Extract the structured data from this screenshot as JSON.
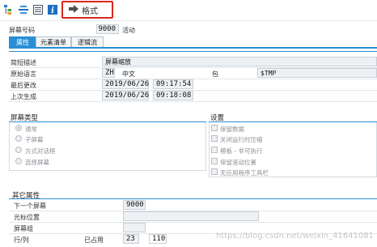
{
  "toolbar": {
    "format_label": "格式",
    "icons": [
      "hierarchy-icon",
      "align-icon",
      "list-icon",
      "info-icon",
      "arrow-right-icon"
    ]
  },
  "header": {
    "screen_no_label": "屏幕号码",
    "screen_no_value": "9000",
    "status": "活动"
  },
  "tabs": [
    {
      "label": "属性",
      "active": true
    },
    {
      "label": "元素清单",
      "active": false
    },
    {
      "label": "逻辑流",
      "active": false
    }
  ],
  "attributes": {
    "short_desc_label": "简短描述",
    "short_desc_value": "屏幕缩放",
    "orig_lang_label": "原始语言",
    "orig_lang_code": "ZH",
    "orig_lang_name": "中文",
    "package_label": "包",
    "package_value": "$TMP",
    "last_changed_label": "最后更改",
    "last_changed_date": "2019/06/26",
    "last_changed_time": "09:17:54",
    "last_gen_label": "上次生成",
    "last_gen_date": "2019/06/26",
    "last_gen_time": "09:18:08"
  },
  "screen_type": {
    "title": "屏幕类型",
    "options": [
      {
        "label": "通常",
        "selected": true
      },
      {
        "label": "子屏幕",
        "selected": false
      },
      {
        "label": "方式对话框",
        "selected": false
      },
      {
        "label": "选择屏幕",
        "selected": false
      }
    ]
  },
  "settings": {
    "title": "设置",
    "options": [
      {
        "label": "保留数据"
      },
      {
        "label": "关闭运行时压缩"
      },
      {
        "label": "模板 - 非可执行"
      },
      {
        "label": "保留滚动位置"
      },
      {
        "label": "无应用程序工具栏"
      }
    ]
  },
  "other": {
    "title": "其它属性",
    "next_screen_label": "下一个屏幕",
    "next_screen_value": "9000",
    "cursor_label": "光标位置",
    "cursor_value": "",
    "screen_group_label": "屏幕组",
    "screen_group_value": "",
    "rows_cols_label": "行/列",
    "occupied_label": "已占用",
    "rows_value": "23",
    "cols_value": "110"
  },
  "watermark": "https://blog.csdn.net/weixin_41641081",
  "colors": {
    "accent": "#2a8fd6",
    "highlight": "#d9281f"
  }
}
